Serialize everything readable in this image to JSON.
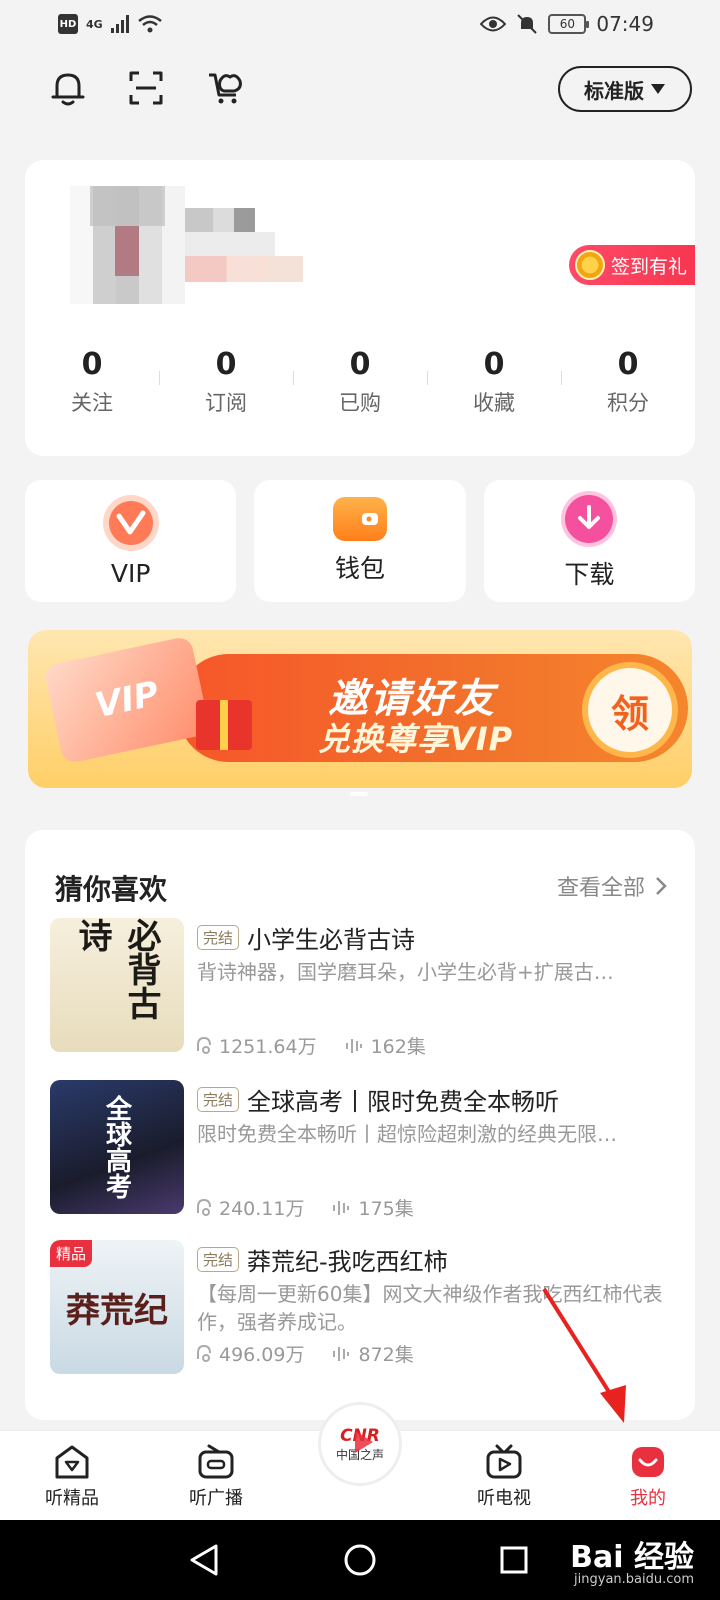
{
  "status_bar": {
    "hd": "HD",
    "network": "4G",
    "battery": "60",
    "time": "07:49"
  },
  "toolbar": {
    "edition_label": "标准版"
  },
  "profile": {
    "checkin_label": "签到有礼",
    "stats": [
      {
        "value": "0",
        "label": "关注"
      },
      {
        "value": "0",
        "label": "订阅"
      },
      {
        "value": "0",
        "label": "已购"
      },
      {
        "value": "0",
        "label": "收藏"
      },
      {
        "value": "0",
        "label": "积分"
      }
    ]
  },
  "tiles": [
    {
      "label": "VIP",
      "icon": "vip-icon",
      "color": "#f04a3a"
    },
    {
      "label": "钱包",
      "icon": "wallet-icon",
      "color": "#ff8a1e"
    },
    {
      "label": "下载",
      "icon": "download-icon",
      "color": "#f14fa0"
    }
  ],
  "banner": {
    "title": "邀请好友",
    "subtitle": "兑换尊享VIP",
    "button": "领",
    "card_text": "VIP"
  },
  "recommend": {
    "heading": "猜你喜欢",
    "more": "查看全部",
    "items": [
      {
        "tag": "完结",
        "title": "小学生必背古诗",
        "desc": "背诗神器，国学磨耳朵，小学生必背+扩展古…",
        "plays": "1251.64万",
        "episodes": "162集",
        "cover_text": "必背古诗",
        "cover_badge": ""
      },
      {
        "tag": "完结",
        "title": "全球高考丨限时免费全本畅听",
        "desc": "限时免费全本畅听丨超惊险超刺激的经典无限…",
        "plays": "240.11万",
        "episodes": "175集",
        "cover_text": "全球高考",
        "cover_badge": ""
      },
      {
        "tag": "完结",
        "title": "莽荒纪-我吃西红柿",
        "desc": "【每周一更新60集】网文大神级作者我吃西红柿代表作，强者养成记。",
        "plays": "496.09万",
        "episodes": "872集",
        "cover_text": "莽荒纪",
        "cover_badge": "精品"
      }
    ]
  },
  "bottom_nav": {
    "items": [
      {
        "label": "听精品"
      },
      {
        "label": "听广播"
      },
      {
        "label": "听电视"
      },
      {
        "label": "我的"
      }
    ],
    "center_logo": "CNR",
    "center_sub": "中国之声"
  },
  "watermark": {
    "brand": "Bai 经验",
    "url": "jingyan.baidu.com"
  },
  "colors": {
    "accent": "#e8303f",
    "background": "#f3f3f3"
  }
}
